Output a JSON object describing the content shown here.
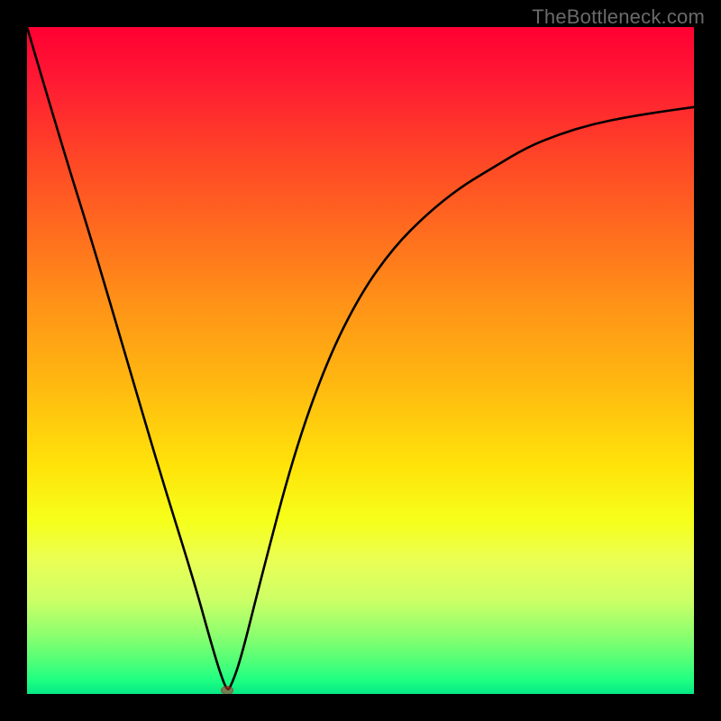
{
  "watermark": "TheBottleneck.com",
  "colors": {
    "frame": "#000000",
    "curve": "#000000",
    "marker": "rgba(200,40,40,0.55)"
  },
  "chart_data": {
    "type": "line",
    "title": "",
    "xlabel": "",
    "ylabel": "",
    "xlim": [
      0,
      1
    ],
    "ylim": [
      0,
      1
    ],
    "grid": false,
    "legend": false,
    "x": [
      0.0,
      0.05,
      0.1,
      0.15,
      0.2,
      0.25,
      0.275,
      0.29,
      0.3,
      0.305,
      0.32,
      0.35,
      0.4,
      0.45,
      0.5,
      0.55,
      0.6,
      0.65,
      0.7,
      0.75,
      0.8,
      0.85,
      0.9,
      0.95,
      1.0
    ],
    "y": [
      1.0,
      0.83,
      0.67,
      0.5,
      0.33,
      0.17,
      0.08,
      0.03,
      0.005,
      0.01,
      0.05,
      0.17,
      0.36,
      0.5,
      0.6,
      0.67,
      0.72,
      0.76,
      0.79,
      0.82,
      0.84,
      0.855,
      0.865,
      0.873,
      0.88
    ],
    "minimum_marker": {
      "x": 0.3,
      "y": 0.005
    },
    "notes": "Values are normalized fractions of the plot area; y=0 is the bottom (green) and y=1 is the top (red). The curve descends steeply from top-left, reaches a minimum near x≈0.30 at the bottom edge, then rises asymptotically toward ~0.88 at the right edge."
  }
}
